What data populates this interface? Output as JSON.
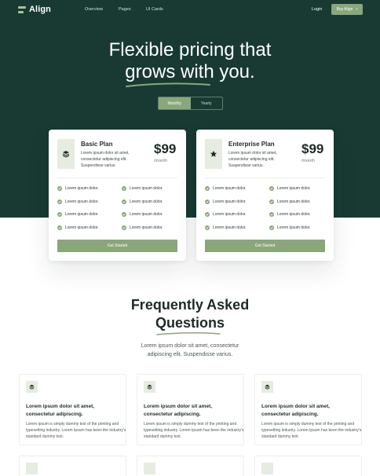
{
  "nav": {
    "brand": "Align",
    "links": [
      "Overview",
      "Pages",
      "UI Cards"
    ],
    "login": "Login",
    "buy": "Buy Align",
    "buy_icon": "arrow-right-icon"
  },
  "hero": {
    "title_line1": "Flexible pricing that",
    "title_line2": "grows with you."
  },
  "billing_toggle": {
    "options": [
      "Monthly",
      "Yearly"
    ],
    "selected": "Monthly"
  },
  "plans": [
    {
      "name": "Basic Plan",
      "icon": "layers-icon",
      "description": "Lorem ipsum dolor sit amet, consectetur adipiscing elit. Suspendisse varius.",
      "price": "$99",
      "period": "/month",
      "features": [
        "Lorem ipsum dolor.",
        "Lorem ipsum dolor.",
        "Lorem ipsum dolor.",
        "Lorem ipsum dolor.",
        "Lorem ipsum dolor.",
        "Lorem ipsum dolor.",
        "Lorem ipsum dolor.",
        "Lorem ipsum dolor."
      ],
      "cta": "Get Started"
    },
    {
      "name": "Enterprise Plan",
      "icon": "star-icon",
      "description": "Lorem ipsum dolor sit amet, consectetur adipiscing elit. Suspendisse varius.",
      "price": "$99",
      "period": "/month",
      "features": [
        "Lorem ipsum dolor.",
        "Lorem ipsum dolor.",
        "Lorem ipsum dolor.",
        "Lorem ipsum dolor.",
        "Lorem ipsum dolor.",
        "Lorem ipsum dolor.",
        "Lorem ipsum dolor.",
        "Lorem ipsum dolor."
      ],
      "cta": "Get Started"
    }
  ],
  "faq": {
    "title_line1": "Frequently Asked",
    "title_line2": "Questions",
    "subtitle": "Lorem ipsum dolor sit amet, consectetur adipiscing elit. Suspendisse varius.",
    "items": [
      {
        "icon": "layers-icon",
        "question": "Lorem ipsum dolor sit amet, consectetur adipiscing.",
        "answer": "Lorem ipsum is simply dummy text of the printing and typesetting industry. Lorem Ipsum has been the industry's standard dummy text."
      },
      {
        "icon": "layers-icon",
        "question": "Lorem ipsum dolor sit amet, consectetur adipiscing.",
        "answer": "Lorem ipsum is simply dummy text of the printing and typesetting industry. Lorem Ipsum has been the industry's standard dummy text."
      },
      {
        "icon": "layers-icon",
        "question": "Lorem ipsum dolor sit amet, consectetur adipiscing.",
        "answer": "Lorem ipsum is simply dummy text of the printing and typesetting industry. Lorem Ipsum has been the industry's standard dummy text."
      }
    ]
  },
  "colors": {
    "hero_bg": "#183a33",
    "accent": "#8aa67b",
    "icon_tile": "#e6ecdf",
    "text_dark": "#1d2b27"
  }
}
